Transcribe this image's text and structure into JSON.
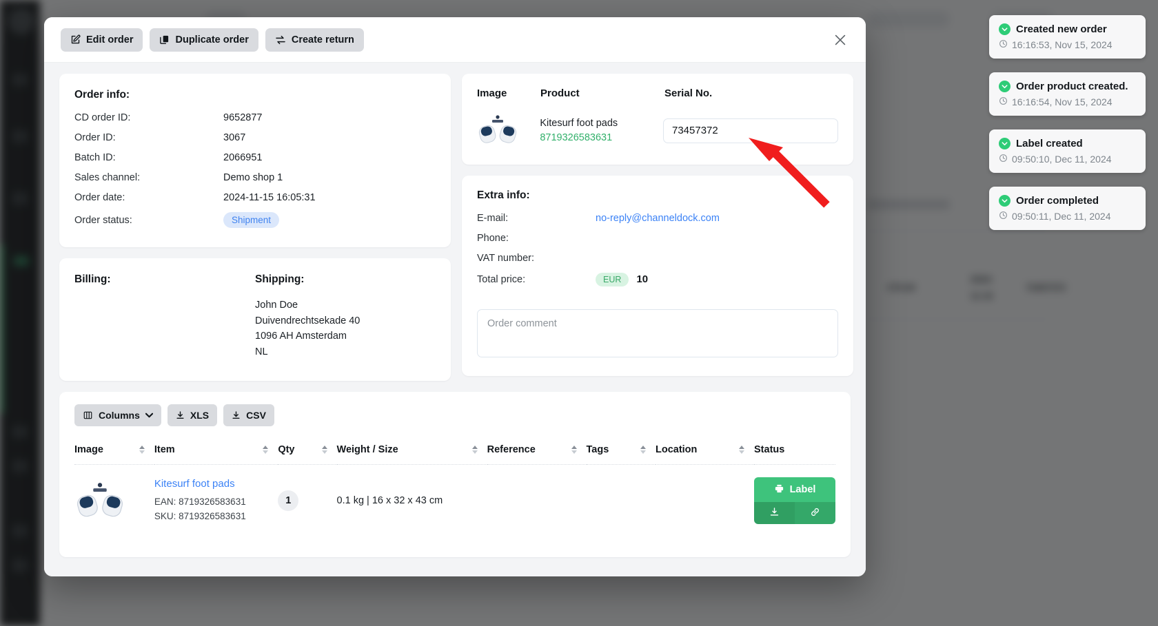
{
  "modal": {
    "toolbar": {
      "edit_order": "Edit order",
      "duplicate_order": "Duplicate order",
      "create_return": "Create return",
      "close_label": "×"
    },
    "order_info": {
      "title": "Order info:",
      "rows": [
        {
          "label": "CD order ID:",
          "value": "9652877",
          "link": false
        },
        {
          "label": "Order ID:",
          "value": "3067",
          "link": false
        },
        {
          "label": "Batch ID:",
          "value": "2066951",
          "link": true
        },
        {
          "label": "Sales channel:",
          "value": "Demo shop 1",
          "link": false
        },
        {
          "label": "Order date:",
          "value": "2024-11-15 16:05:31",
          "link": false
        }
      ],
      "status_label": "Order status:",
      "status_value": "Shipment"
    },
    "billing": {
      "title": "Billing:",
      "lines": []
    },
    "shipping": {
      "title": "Shipping:",
      "lines": [
        "John Doe",
        "Duivendrechtsekade 40",
        "1096 AH Amsterdam",
        "NL"
      ]
    },
    "product_panel": {
      "headers": {
        "image": "Image",
        "product": "Product",
        "serial": "Serial No."
      },
      "product_name": "Kitesurf foot pads",
      "product_ean": "8719326583631",
      "serial_value": "73457372"
    },
    "extra_info": {
      "title": "Extra info:",
      "email_label": "E-mail:",
      "email_value": "no-reply@channeldock.com",
      "phone_label": "Phone:",
      "phone_value": "",
      "vat_label": "VAT number:",
      "vat_value": "",
      "total_label": "Total price:",
      "currency": "EUR",
      "total_value": "10",
      "comment_placeholder": "Order comment",
      "comment_value": ""
    },
    "items_table": {
      "toolbar": {
        "columns": "Columns",
        "xls": "XLS",
        "csv": "CSV"
      },
      "columns": [
        "Image",
        "Item",
        "Qty",
        "Weight / Size",
        "Reference",
        "Tags",
        "Location",
        "Status"
      ],
      "rows": [
        {
          "item_name": "Kitesurf foot pads",
          "ean": "EAN: 8719326583631",
          "sku": "SKU: 8719326583631",
          "qty": "1",
          "weight_size": "0.1 kg | 16 x 32 x 43 cm",
          "reference": "",
          "tags": "",
          "location": "",
          "status_button": "Label"
        }
      ]
    }
  },
  "events": [
    {
      "title": "Created new order",
      "time": "16:16:53, Nov 15, 2024"
    },
    {
      "title": "Order product created.",
      "time": "16:16:54, Nov 15, 2024"
    },
    {
      "title": "Label created",
      "time": "09:50:10, Dec 11, 2024"
    },
    {
      "title": "Order completed",
      "time": "09:50:11, Dec 11, 2024"
    }
  ],
  "colors": {
    "accent_green": "#2ecc77",
    "link_blue": "#3b82f6",
    "status_blue_bg": "#dbe7fb",
    "currency_green_bg": "#d8f3e2",
    "annotation_red": "#f01d1d"
  }
}
